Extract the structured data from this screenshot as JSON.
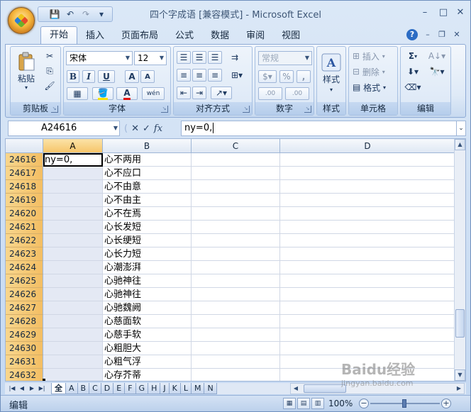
{
  "window": {
    "title": "四个字成语  [兼容模式] - Microsoft Excel",
    "minimize": "–",
    "maximize": "□",
    "close": "✕"
  },
  "qat": {
    "save": "💾",
    "undo": "↶",
    "redo": "↷",
    "more": "▾"
  },
  "tabs": [
    {
      "label": "开始",
      "active": true
    },
    {
      "label": "插入"
    },
    {
      "label": "页面布局"
    },
    {
      "label": "公式"
    },
    {
      "label": "数据"
    },
    {
      "label": "审阅"
    },
    {
      "label": "视图"
    }
  ],
  "ribbon": {
    "clipboard": {
      "label": "剪贴板",
      "paste": "粘贴"
    },
    "font": {
      "label": "字体",
      "name": "宋体",
      "size": "12",
      "bold": "B",
      "italic": "I",
      "underline": "U",
      "grow": "A",
      "shrink": "A",
      "font_color": "A",
      "wen": "wén"
    },
    "alignment": {
      "label": "对齐方式"
    },
    "number": {
      "label": "数字",
      "format": "常规",
      "percent": "%",
      "comma": ",",
      "inc": ".00",
      "dec": ".00"
    },
    "styles": {
      "label": "样式",
      "button": "样式"
    },
    "cells": {
      "label": "单元格",
      "insert": "插入",
      "delete": "删除",
      "format": "格式"
    },
    "editing": {
      "label": "编辑",
      "sum": "Σ"
    }
  },
  "formula_bar": {
    "name_box": "A24616",
    "formula": "ny=0,",
    "fx": "fx"
  },
  "sheet": {
    "columns": [
      "A",
      "B",
      "C",
      "D"
    ],
    "rows": [
      {
        "num": "24616",
        "a": "ny=0,",
        "b": "心不两用"
      },
      {
        "num": "24617",
        "a": "",
        "b": "心不应口"
      },
      {
        "num": "24618",
        "a": "",
        "b": "心不由意"
      },
      {
        "num": "24619",
        "a": "",
        "b": "心不由主"
      },
      {
        "num": "24620",
        "a": "",
        "b": "心不在焉"
      },
      {
        "num": "24621",
        "a": "",
        "b": "心长发短"
      },
      {
        "num": "24622",
        "a": "",
        "b": "心长绠短"
      },
      {
        "num": "24623",
        "a": "",
        "b": "心长力短"
      },
      {
        "num": "24624",
        "a": "",
        "b": "心潮澎湃"
      },
      {
        "num": "24625",
        "a": "",
        "b": "心驰神往"
      },
      {
        "num": "24626",
        "a": "",
        "b": "心驰神往"
      },
      {
        "num": "24627",
        "a": "",
        "b": "心驰魏阙"
      },
      {
        "num": "24628",
        "a": "",
        "b": "心慈面软"
      },
      {
        "num": "24629",
        "a": "",
        "b": "心慈手软"
      },
      {
        "num": "24630",
        "a": "",
        "b": "心粗胆大"
      },
      {
        "num": "24631",
        "a": "",
        "b": "心粗气浮"
      },
      {
        "num": "24632",
        "a": "",
        "b": "心存芥蒂"
      }
    ]
  },
  "sheet_tabs": [
    "全",
    "A",
    "B",
    "C",
    "D",
    "E",
    "F",
    "G",
    "H",
    "J",
    "K",
    "L",
    "M",
    "N"
  ],
  "status": {
    "mode": "编辑",
    "zoom": "100%"
  },
  "watermark": {
    "text": "Baidu经验",
    "sub": "jingyan.baidu.com"
  }
}
